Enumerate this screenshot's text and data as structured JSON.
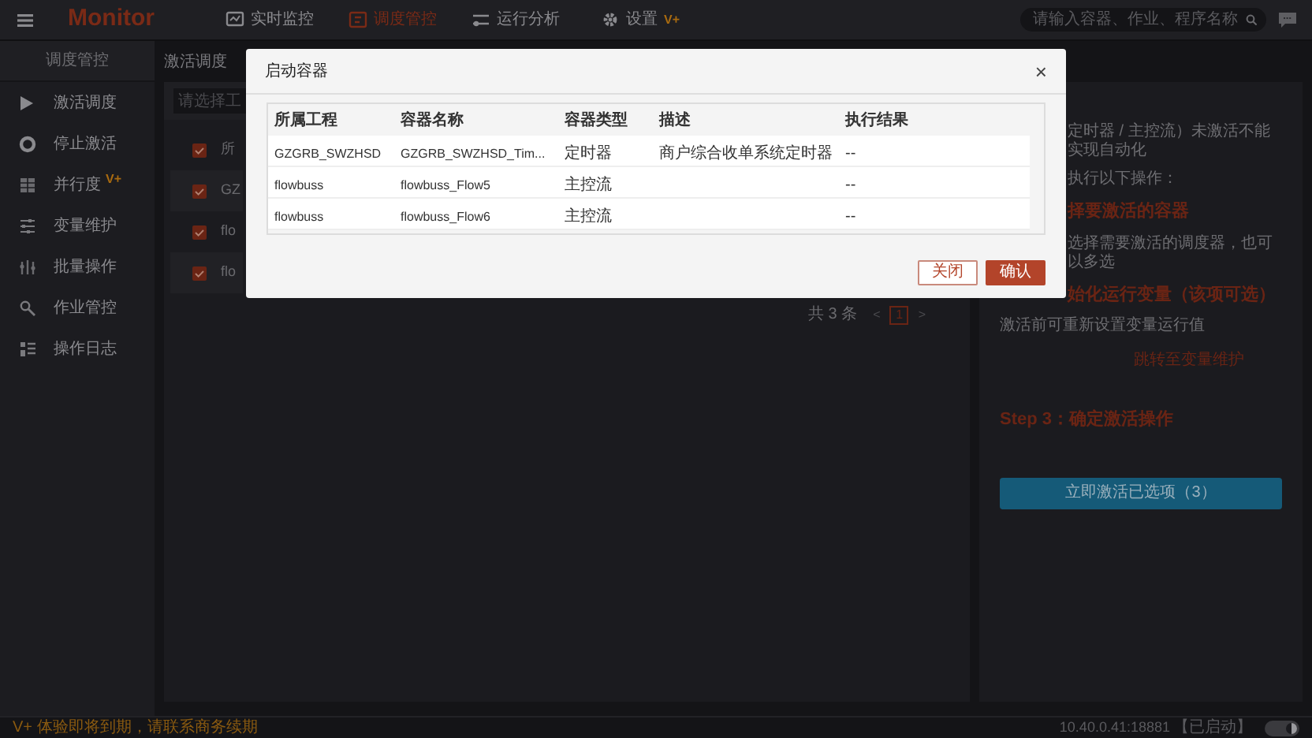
{
  "top_bar": {
    "logo": "Monitor",
    "nav": [
      {
        "label": "实时监控",
        "selected": false
      },
      {
        "label": "调度管控",
        "selected": true
      },
      {
        "label": "运行分析",
        "selected": false
      },
      {
        "label": "设置",
        "selected": false,
        "badge": "V+"
      }
    ],
    "search": {
      "placeholder": "请输入容器、作业、程序名称"
    }
  },
  "sidebar": {
    "title": "调度管控",
    "items": [
      {
        "label": "激活调度"
      },
      {
        "label": "停止激活"
      },
      {
        "label": "并行度",
        "badge": "V+"
      },
      {
        "label": "变量维护"
      },
      {
        "label": "批量操作"
      },
      {
        "label": "作业管控"
      },
      {
        "label": "操作日志"
      }
    ]
  },
  "main": {
    "title": "激活调度",
    "filter": {
      "placeholder": "请选择工"
    },
    "table": {
      "header": {
        "checked": true,
        "text": "所"
      },
      "rows": [
        {
          "checked": true,
          "text": "GZ"
        },
        {
          "checked": true,
          "text": "flo"
        },
        {
          "checked": true,
          "text": "flo"
        }
      ]
    },
    "pagination": {
      "total": "共 3 条",
      "prev": "<",
      "pages": [
        {
          "label": "1",
          "selected": true
        }
      ],
      "next": ">"
    }
  },
  "guide": {
    "lines": [
      {
        "kind": "text",
        "text": "定时器 / 主控流）未激活不能实现自动化"
      },
      {
        "kind": "text",
        "text": "执行以下操作："
      },
      {
        "kind": "step",
        "text": "择要激活的容器"
      },
      {
        "kind": "text",
        "text": "选择需要激活的调度器，也可以多选"
      },
      {
        "kind": "step",
        "text": "始化运行变量（该项可选）"
      },
      {
        "kind": "text",
        "text": "激活前可重新设置变量运行值"
      },
      {
        "kind": "link",
        "text": "跳转至变量维护"
      },
      {
        "kind": "step",
        "text": "Step 3：确定激活操作"
      }
    ],
    "action": "立即激活已选项（3）"
  },
  "status_bar": {
    "notice": "V+ 体验即将到期，请联系商务续期",
    "server": "10.40.0.41:18881",
    "state": "【已启动】",
    "dark_mode": {
      "on": true
    }
  },
  "dialog": {
    "title": "启动容器",
    "close": "×",
    "columns": [
      "所属工程",
      "容器名称",
      "容器类型",
      "描述",
      "执行结果"
    ],
    "rows": [
      [
        "GZGRB_SWZHSD",
        "GZGRB_SWZHSD_Tim...",
        "定时器",
        "商户综合收单系统定时器",
        "--"
      ],
      [
        "flowbuss",
        "flowbuss_Flow5",
        "主控流",
        "",
        "--"
      ],
      [
        "flowbuss",
        "flowbuss_Flow6",
        "主控流",
        "",
        "--"
      ]
    ],
    "buttons": [
      {
        "label": "关闭",
        "kind": "secondary"
      },
      {
        "label": "确认",
        "kind": "primary"
      }
    ]
  }
}
